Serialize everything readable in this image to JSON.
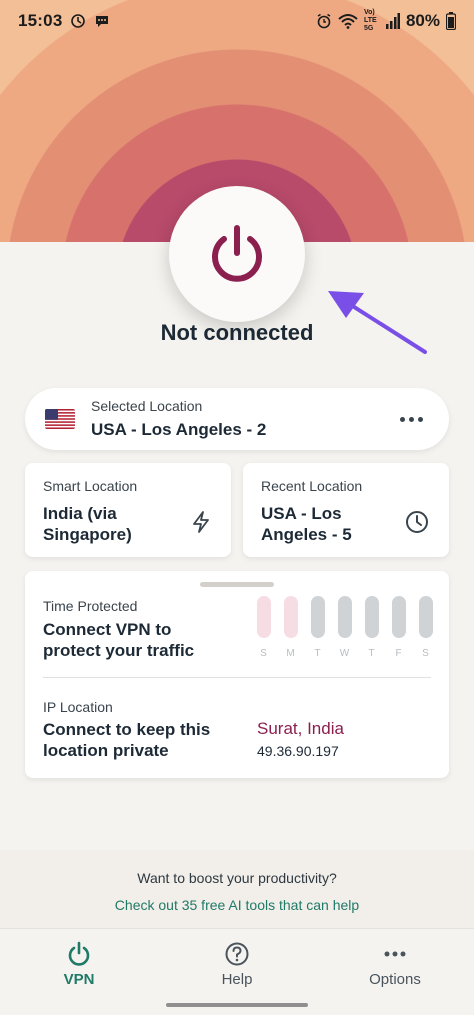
{
  "status_bar": {
    "time": "15:03",
    "battery": "80%",
    "network": "Vo) LTE 5G",
    "icons": [
      "sync-icon",
      "chat-icon",
      "alarm-icon",
      "wifi-icon",
      "signal-icon",
      "battery-icon"
    ]
  },
  "connection": {
    "status": "Not connected",
    "power_icon": "power-icon",
    "accent": "#8b1f4e"
  },
  "selected_location": {
    "label": "Selected Location",
    "value": "USA - Los Angeles - 2",
    "flag": "us-flag-icon",
    "menu_icon": "more-dots-icon"
  },
  "smart_location": {
    "label": "Smart Location",
    "value": "India (via Singapore)",
    "icon": "lightning-icon"
  },
  "recent_location": {
    "label": "Recent Location",
    "value": "USA - Los Angeles - 5",
    "icon": "clock-icon"
  },
  "time_protected": {
    "label": "Time Protected",
    "text": "Connect VPN to protect your traffic",
    "days": [
      {
        "day": "S",
        "highlight": true
      },
      {
        "day": "M",
        "highlight": true
      },
      {
        "day": "T",
        "highlight": false
      },
      {
        "day": "W",
        "highlight": false
      },
      {
        "day": "T",
        "highlight": false
      },
      {
        "day": "F",
        "highlight": false
      },
      {
        "day": "S",
        "highlight": false
      }
    ]
  },
  "ip_location": {
    "label": "IP Location",
    "text": "Connect to keep this location private",
    "city": "Surat, India",
    "ip": "49.36.90.197"
  },
  "promo": {
    "question": "Want to boost your productivity?",
    "link": "Check out 35 free AI tools that can help"
  },
  "nav": {
    "items": [
      {
        "label": "VPN",
        "icon": "power-icon",
        "active": true
      },
      {
        "label": "Help",
        "icon": "help-icon",
        "active": false
      },
      {
        "label": "Options",
        "icon": "more-dots-icon",
        "active": false
      }
    ]
  },
  "colors": {
    "brand_green": "#1f7a67",
    "brand_maroon": "#8b1f4e",
    "annotation_arrow": "#7a4fe8"
  }
}
